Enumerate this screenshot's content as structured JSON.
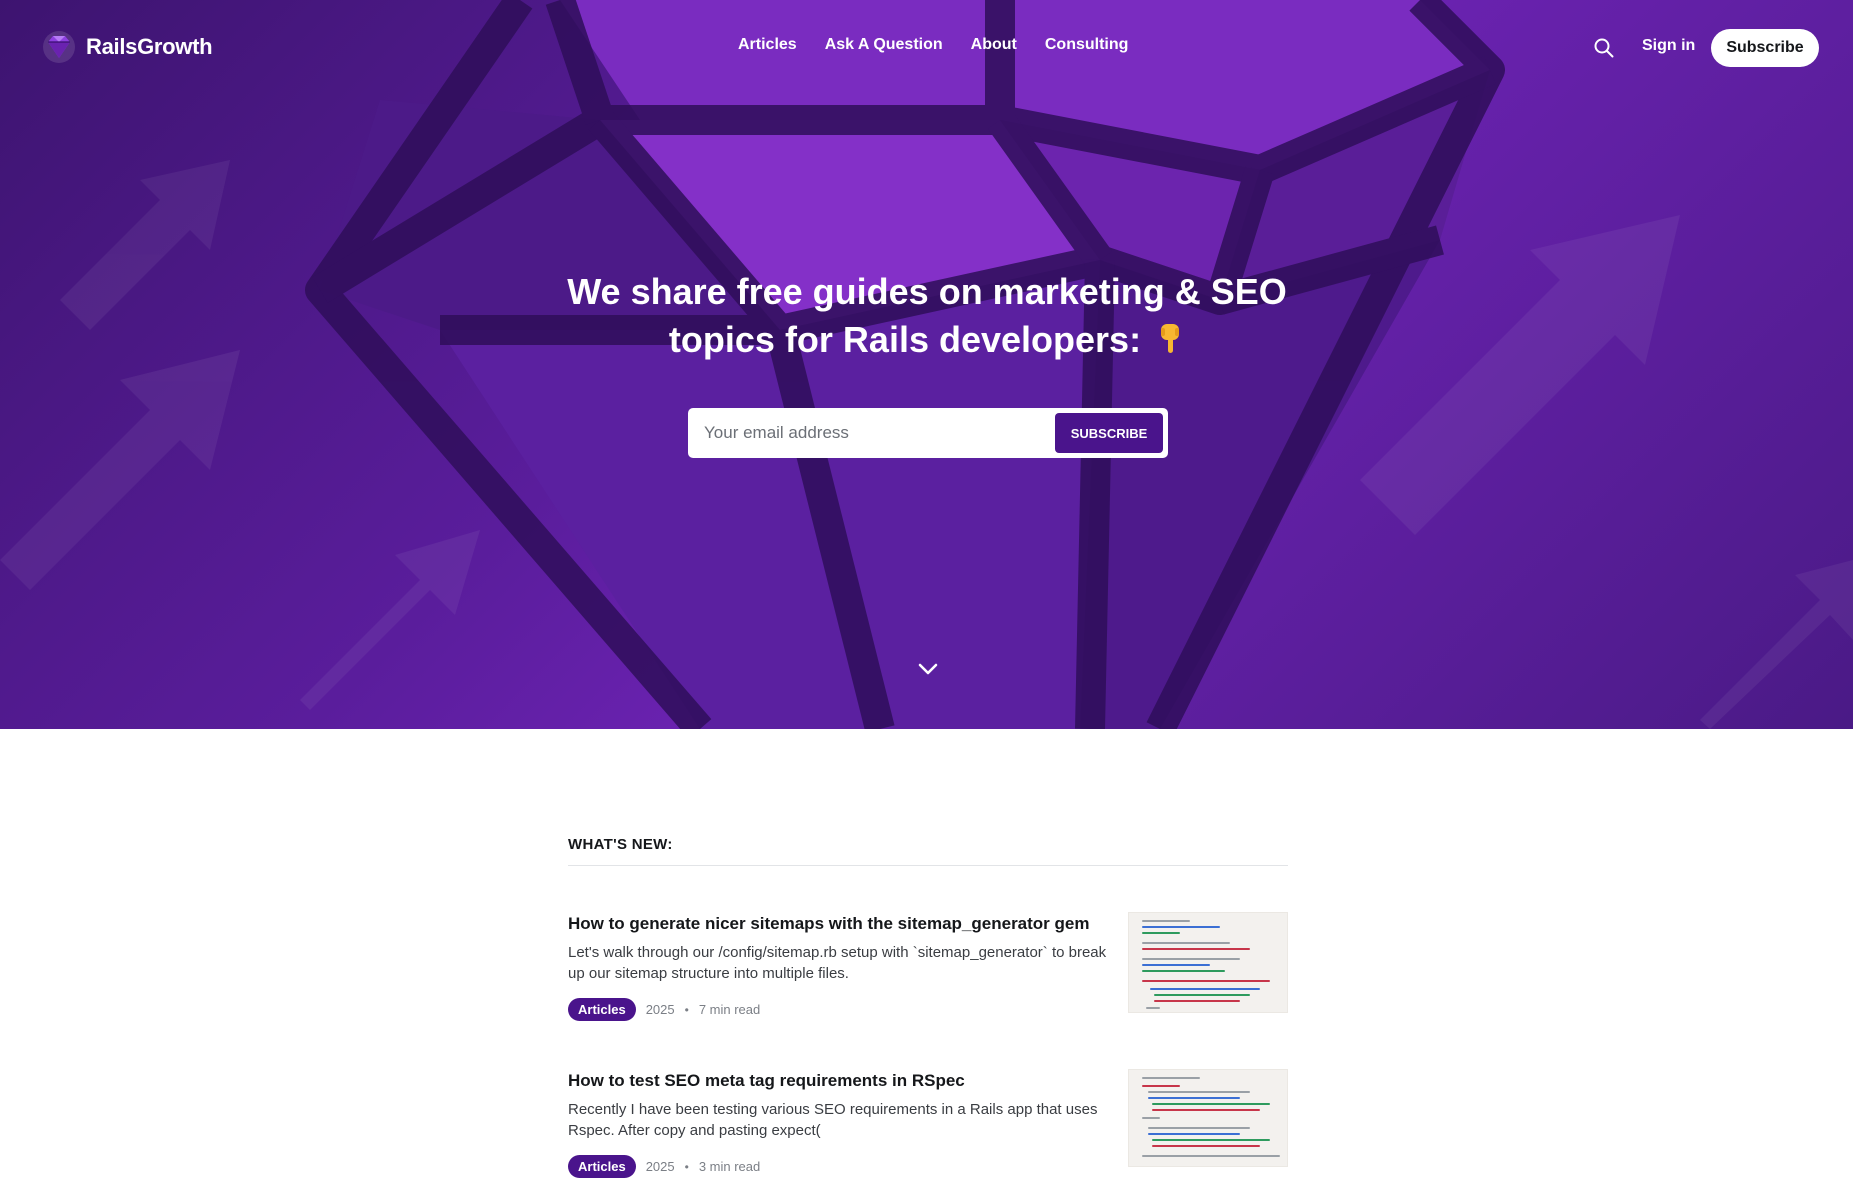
{
  "brand": {
    "name": "RailsGrowth"
  },
  "nav": {
    "links": [
      "Articles",
      "Ask A Question",
      "About",
      "Consulting"
    ],
    "signin": "Sign in",
    "subscribe": "Subscribe"
  },
  "hero": {
    "headline_line1": "We share free guides on marketing & SEO",
    "headline_line2": "topics for Rails developers:",
    "email_placeholder": "Your email address",
    "subscribe_button": "SUBSCRIBE"
  },
  "feed": {
    "title": "WHAT'S NEW:",
    "posts": [
      {
        "title": "How to generate nicer sitemaps with the sitemap_generator gem",
        "excerpt": "Let's walk through our /config/sitemap.rb setup with `sitemap_generator` to break up our sitemap structure into multiple files.",
        "tag": "Articles",
        "year": "2025",
        "read_time": "7 min read"
      },
      {
        "title": "How to test SEO meta tag requirements in RSpec",
        "excerpt": "Recently I have been testing various SEO requirements in a Rails app that uses Rspec. After copy and pasting expect(",
        "tag": "Articles",
        "year": "2025",
        "read_time": "3 min read"
      }
    ]
  },
  "colors": {
    "hero_purple": "#5a1d9c",
    "accent": "#4a148c",
    "white": "#ffffff"
  },
  "icons": [
    "gem-logo-icon",
    "search-icon",
    "pointing-down-emoji-icon",
    "chevron-down-icon"
  ]
}
